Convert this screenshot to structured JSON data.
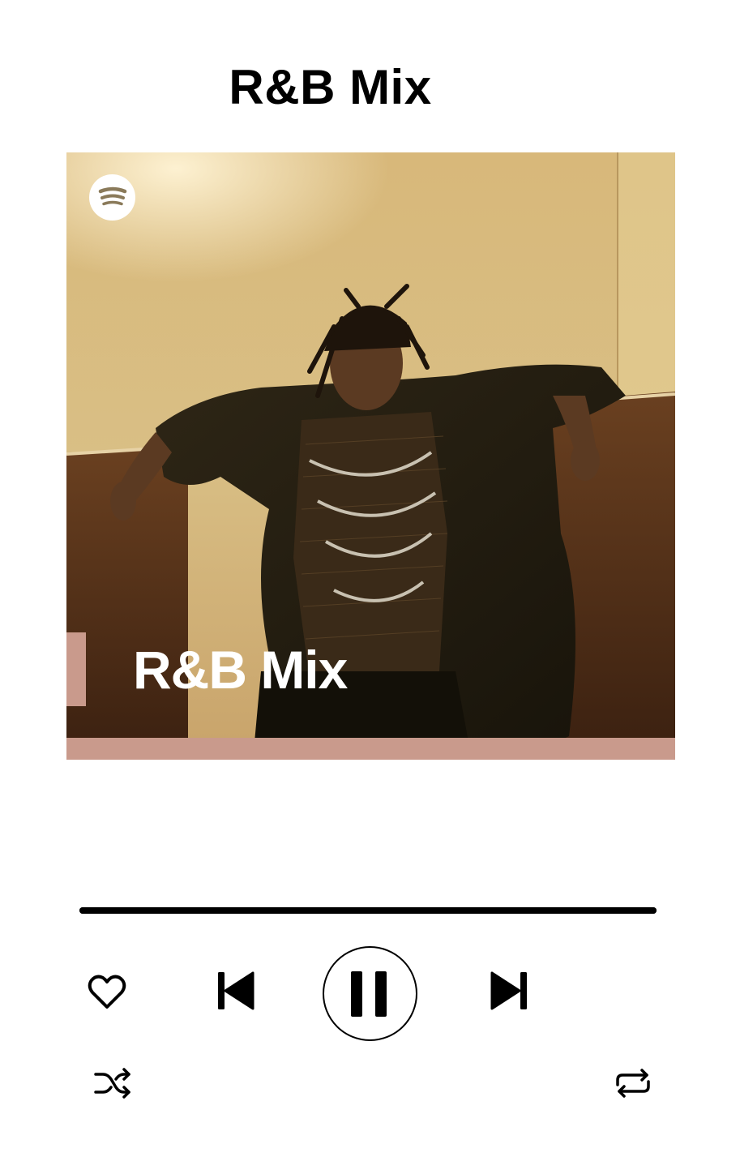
{
  "header": {
    "title": "R&B Mix"
  },
  "cover": {
    "label": "R&B Mix",
    "logo_icon": "spotify-logo-icon",
    "accent_color": "#c99a8c"
  },
  "player": {
    "progress_fraction": 1.0,
    "state": "playing",
    "controls": {
      "like_icon": "heart-outline-icon",
      "previous_icon": "skip-previous-icon",
      "pause_icon": "pause-icon",
      "next_icon": "skip-next-icon",
      "shuffle_icon": "shuffle-icon",
      "repeat_icon": "repeat-icon"
    }
  },
  "colors": {
    "background": "#ffffff",
    "foreground": "#000000",
    "cover_text": "#ffffff"
  }
}
